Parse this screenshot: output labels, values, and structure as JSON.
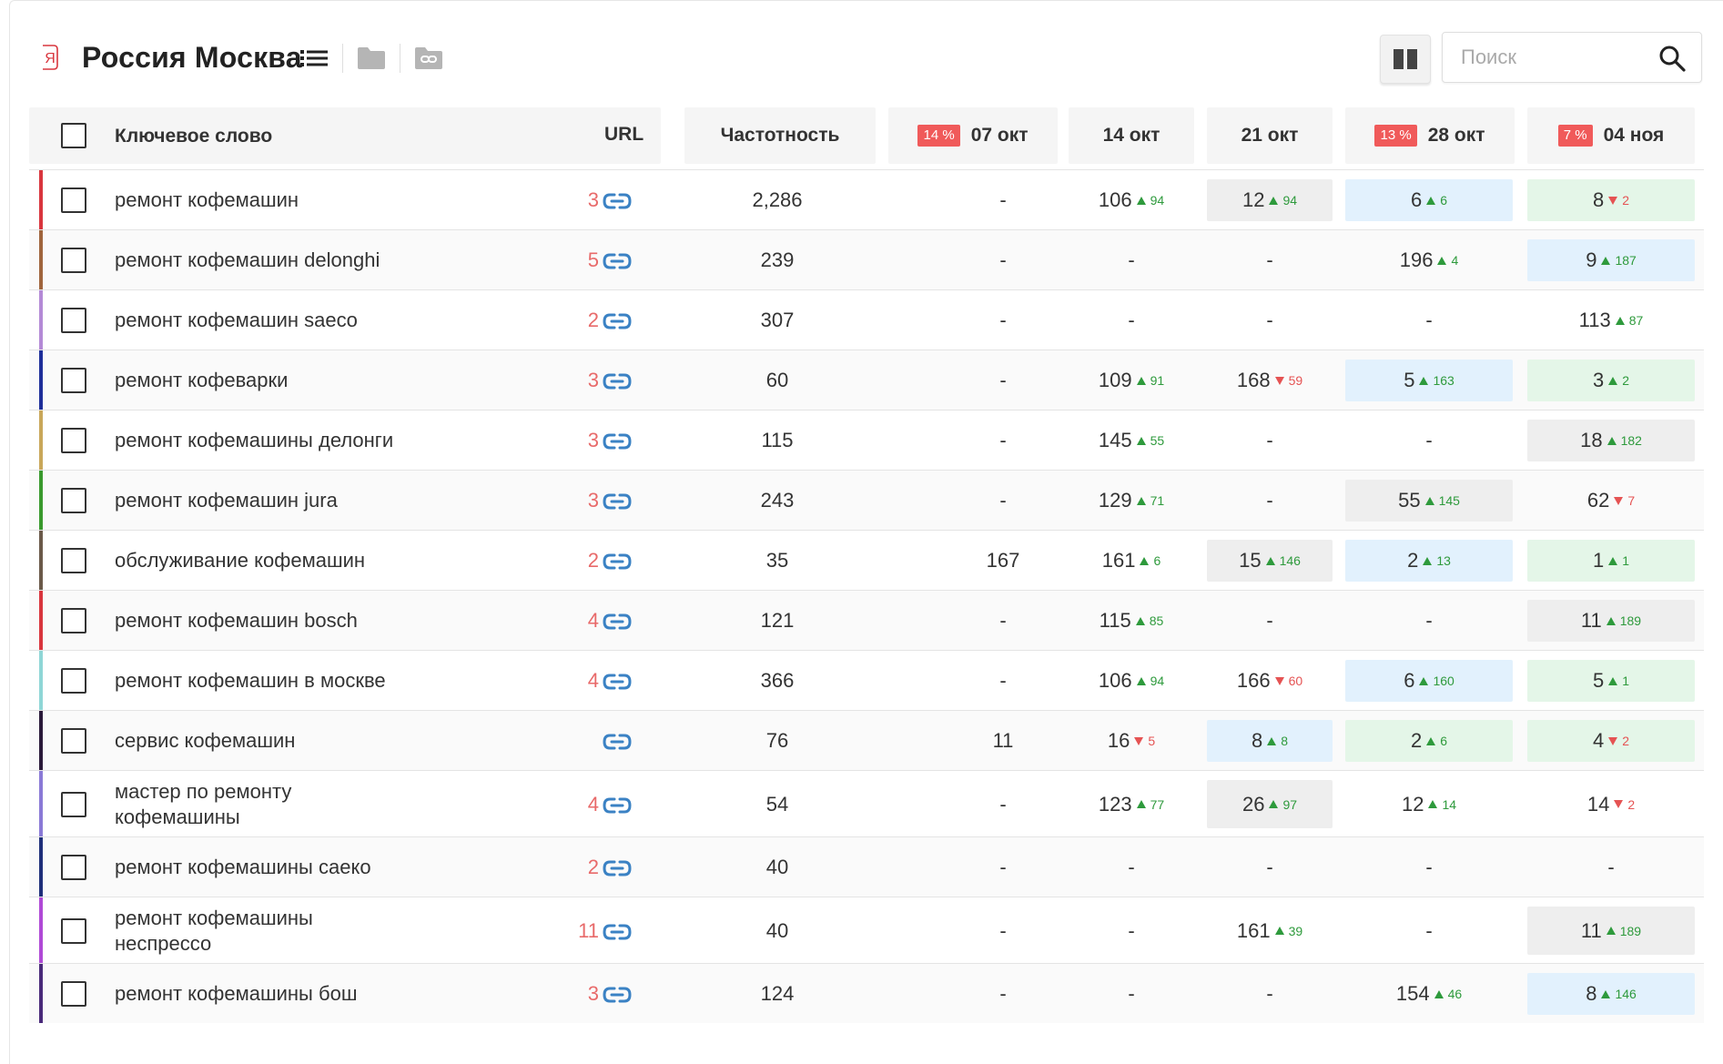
{
  "header": {
    "logo_letter": "Я",
    "title": "Россия Москва",
    "icons": [
      "list-icon",
      "folder-icon",
      "link-folder-icon"
    ],
    "columns_toggle_icon": "columns-icon",
    "search": {
      "placeholder": "Поиск",
      "value": "",
      "icon": "search-icon"
    }
  },
  "colors": {
    "accent_red": "#f05a5a",
    "up_green": "#2e9a3c",
    "down_red": "#e55353",
    "link_blue": "#3b82c4",
    "cell_gray": "#eeeeee",
    "cell_blue": "#e2f1fd",
    "cell_green": "#e4f6e8"
  },
  "table": {
    "columns": {
      "keyword": "Ключевое слово",
      "url": "URL",
      "frequency": "Частотность",
      "dates": [
        {
          "label": "07 окт",
          "badge": "14 %"
        },
        {
          "label": "14 окт",
          "badge": ""
        },
        {
          "label": "21 окт",
          "badge": ""
        },
        {
          "label": "28 окт",
          "badge": "13 %"
        },
        {
          "label": "04 ноя",
          "badge": "7 %"
        }
      ]
    },
    "rows": [
      {
        "color": "#d9363e",
        "keyword": "ремонт кофемашин",
        "url_count": "3",
        "frequency": "2,286",
        "cells": [
          {
            "v": "-"
          },
          {
            "v": "106",
            "d": "94",
            "dir": "up"
          },
          {
            "v": "12",
            "d": "94",
            "dir": "up",
            "bg": "gray"
          },
          {
            "v": "6",
            "d": "6",
            "dir": "up",
            "bg": "blue"
          },
          {
            "v": "8",
            "d": "2",
            "dir": "down",
            "bg": "green"
          }
        ]
      },
      {
        "color": "#a0653d",
        "keyword": "ремонт кофемашин delonghi",
        "url_count": "5",
        "frequency": "239",
        "cells": [
          {
            "v": "-"
          },
          {
            "v": "-"
          },
          {
            "v": "-"
          },
          {
            "v": "196",
            "d": "4",
            "dir": "up"
          },
          {
            "v": "9",
            "d": "187",
            "dir": "up",
            "bg": "blue"
          }
        ]
      },
      {
        "color": "#b48ad6",
        "keyword": "ремонт кофемашин saeco",
        "url_count": "2",
        "frequency": "307",
        "cells": [
          {
            "v": "-"
          },
          {
            "v": "-"
          },
          {
            "v": "-"
          },
          {
            "v": "-"
          },
          {
            "v": "113",
            "d": "87",
            "dir": "up"
          }
        ]
      },
      {
        "color": "#1f2f9a",
        "keyword": "ремонт кофеварки",
        "url_count": "3",
        "frequency": "60",
        "cells": [
          {
            "v": "-"
          },
          {
            "v": "109",
            "d": "91",
            "dir": "up"
          },
          {
            "v": "168",
            "d": "59",
            "dir": "down"
          },
          {
            "v": "5",
            "d": "163",
            "dir": "up",
            "bg": "blue"
          },
          {
            "v": "3",
            "d": "2",
            "dir": "up",
            "bg": "green"
          }
        ]
      },
      {
        "color": "#c9a75a",
        "keyword": "ремонт кофемашины делонги",
        "url_count": "3",
        "frequency": "115",
        "cells": [
          {
            "v": "-"
          },
          {
            "v": "145",
            "d": "55",
            "dir": "up"
          },
          {
            "v": "-"
          },
          {
            "v": "-"
          },
          {
            "v": "18",
            "d": "182",
            "dir": "up",
            "bg": "gray"
          }
        ]
      },
      {
        "color": "#3a9a2e",
        "keyword": "ремонт кофемашин jura",
        "url_count": "3",
        "frequency": "243",
        "cells": [
          {
            "v": "-"
          },
          {
            "v": "129",
            "d": "71",
            "dir": "up"
          },
          {
            "v": "-"
          },
          {
            "v": "55",
            "d": "145",
            "dir": "up",
            "bg": "gray"
          },
          {
            "v": "62",
            "d": "7",
            "dir": "down"
          }
        ]
      },
      {
        "color": "#6b5a4a",
        "keyword": "обслуживание кофемашин",
        "url_count": "2",
        "frequency": "35",
        "cells": [
          {
            "v": "167"
          },
          {
            "v": "161",
            "d": "6",
            "dir": "up"
          },
          {
            "v": "15",
            "d": "146",
            "dir": "up",
            "bg": "gray"
          },
          {
            "v": "2",
            "d": "13",
            "dir": "up",
            "bg": "blue"
          },
          {
            "v": "1",
            "d": "1",
            "dir": "up",
            "bg": "green"
          }
        ]
      },
      {
        "color": "#d9363e",
        "keyword": "ремонт кофемашин bosch",
        "url_count": "4",
        "frequency": "121",
        "cells": [
          {
            "v": "-"
          },
          {
            "v": "115",
            "d": "85",
            "dir": "up"
          },
          {
            "v": "-"
          },
          {
            "v": "-"
          },
          {
            "v": "11",
            "d": "189",
            "dir": "up",
            "bg": "gray"
          }
        ]
      },
      {
        "color": "#8fd6d6",
        "keyword": "ремонт кофемашин в москве",
        "url_count": "4",
        "frequency": "366",
        "cells": [
          {
            "v": "-"
          },
          {
            "v": "106",
            "d": "94",
            "dir": "up"
          },
          {
            "v": "166",
            "d": "60",
            "dir": "down"
          },
          {
            "v": "6",
            "d": "160",
            "dir": "up",
            "bg": "blue"
          },
          {
            "v": "5",
            "d": "1",
            "dir": "up",
            "bg": "green"
          }
        ]
      },
      {
        "color": "#2a1a3a",
        "keyword": "сервис кофемашин",
        "url_count": "",
        "frequency": "76",
        "cells": [
          {
            "v": "11"
          },
          {
            "v": "16",
            "d": "5",
            "dir": "down"
          },
          {
            "v": "8",
            "d": "8",
            "dir": "up",
            "bg": "blue"
          },
          {
            "v": "2",
            "d": "6",
            "dir": "up",
            "bg": "green"
          },
          {
            "v": "4",
            "d": "2",
            "dir": "down",
            "bg": "green"
          }
        ]
      },
      {
        "color": "#8a7ad6",
        "keyword": "мастер по ремонту кофемашины",
        "url_count": "4",
        "frequency": "54",
        "tall": true,
        "cells": [
          {
            "v": "-"
          },
          {
            "v": "123",
            "d": "77",
            "dir": "up"
          },
          {
            "v": "26",
            "d": "97",
            "dir": "up",
            "bg": "gray"
          },
          {
            "v": "12",
            "d": "14",
            "dir": "up"
          },
          {
            "v": "14",
            "d": "2",
            "dir": "down"
          }
        ]
      },
      {
        "color": "#1f2f7a",
        "keyword": "ремонт кофемашины саеко",
        "url_count": "2",
        "frequency": "40",
        "cells": [
          {
            "v": "-"
          },
          {
            "v": "-"
          },
          {
            "v": "-"
          },
          {
            "v": "-"
          },
          {
            "v": "-"
          }
        ]
      },
      {
        "color": "#b04ad6",
        "keyword": "ремонт кофемашины неспрессо",
        "url_count": "11",
        "frequency": "40",
        "tall": true,
        "cells": [
          {
            "v": "-"
          },
          {
            "v": "-"
          },
          {
            "v": "161",
            "d": "39",
            "dir": "up"
          },
          {
            "v": "-"
          },
          {
            "v": "11",
            "d": "189",
            "dir": "up",
            "bg": "gray"
          }
        ]
      },
      {
        "color": "#4a2a7a",
        "keyword": "ремонт кофемашины бош",
        "url_count": "3",
        "frequency": "124",
        "cells": [
          {
            "v": "-"
          },
          {
            "v": "-"
          },
          {
            "v": "-"
          },
          {
            "v": "154",
            "d": "46",
            "dir": "up"
          },
          {
            "v": "8",
            "d": "146",
            "dir": "up",
            "bg": "blue"
          }
        ]
      }
    ]
  }
}
